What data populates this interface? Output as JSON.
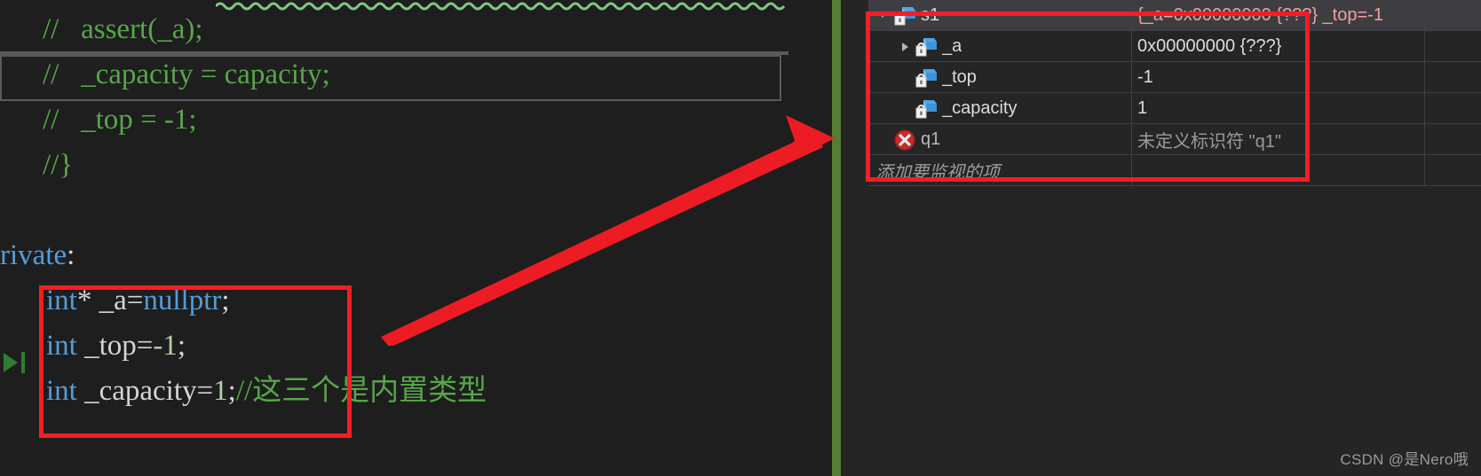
{
  "editor": {
    "lines": [
      {
        "indent": 48,
        "segments": [
          {
            "cls": "cmt",
            "text": "//   assert(_a);"
          }
        ]
      },
      {
        "indent": 48,
        "segments": [
          {
            "cls": "cmt",
            "text": "//   _capacity = capacity;"
          }
        ]
      },
      {
        "indent": 48,
        "segments": [
          {
            "cls": "cmt",
            "text": "//   _top = -1;"
          }
        ]
      },
      {
        "indent": 48,
        "segments": [
          {
            "cls": "cmt",
            "text": "//}"
          }
        ]
      },
      {
        "indent": 0,
        "segments": []
      },
      {
        "indent": 0,
        "segments": [
          {
            "cls": "kw",
            "text": "rivate"
          },
          {
            "cls": "punc",
            "text": ":"
          }
        ]
      },
      {
        "indent": 52,
        "segments": [
          {
            "cls": "kw",
            "text": "int"
          },
          {
            "cls": "punc",
            "text": "* "
          },
          {
            "cls": "id",
            "text": "_a"
          },
          {
            "cls": "punc",
            "text": "="
          },
          {
            "cls": "kw",
            "text": "nullptr"
          },
          {
            "cls": "punc",
            "text": ";"
          }
        ]
      },
      {
        "indent": 52,
        "segments": [
          {
            "cls": "kw",
            "text": "int"
          },
          {
            "cls": "id",
            "text": " _top"
          },
          {
            "cls": "punc",
            "text": "="
          },
          {
            "cls": "num",
            "text": "-1"
          },
          {
            "cls": "punc",
            "text": ";"
          }
        ]
      },
      {
        "indent": 52,
        "segments": [
          {
            "cls": "kw",
            "text": "int"
          },
          {
            "cls": "id",
            "text": " _capacity"
          },
          {
            "cls": "punc",
            "text": "="
          },
          {
            "cls": "num",
            "text": "1"
          },
          {
            "cls": "punc",
            "text": ";"
          },
          {
            "cls": "cmt",
            "text": "//这三个是内置类型"
          }
        ]
      }
    ],
    "accent_highlight_color": "#5a5a5a",
    "annotation_color": "#f81d24",
    "squiggle_color": "#7fc97f",
    "breakpoint_marker_color": "#3f8a3f"
  },
  "watch": {
    "columns": [
      "",
      "",
      ""
    ],
    "rows": [
      {
        "depth": 0,
        "expander": "expanded",
        "icon": "field-private-icon",
        "name": "s1",
        "value": "{_a=0x00000000 {???} _top=-1",
        "selected": true,
        "error": false
      },
      {
        "depth": 1,
        "expander": "collapsed",
        "icon": "field-private-icon",
        "name": "_a",
        "value": "0x00000000 {???}",
        "selected": false,
        "error": false
      },
      {
        "depth": 1,
        "expander": "blank",
        "icon": "field-private-icon",
        "name": "_top",
        "value": "-1",
        "selected": false,
        "error": false
      },
      {
        "depth": 1,
        "expander": "blank",
        "icon": "field-private-icon",
        "name": "_capacity",
        "value": "1",
        "selected": false,
        "error": false
      },
      {
        "depth": 0,
        "expander": "blank",
        "icon": "error-circle-icon",
        "name": "q1",
        "value": "未定义标识符 \"q1\"",
        "selected": false,
        "error": true
      }
    ],
    "add_item_placeholder": "添加要监视的项",
    "background_color": "#252526",
    "selected_row_color": "#3e3e42",
    "grid_color": "#3f3f46"
  },
  "watermark": {
    "text": "CSDN @是Nero哦"
  }
}
